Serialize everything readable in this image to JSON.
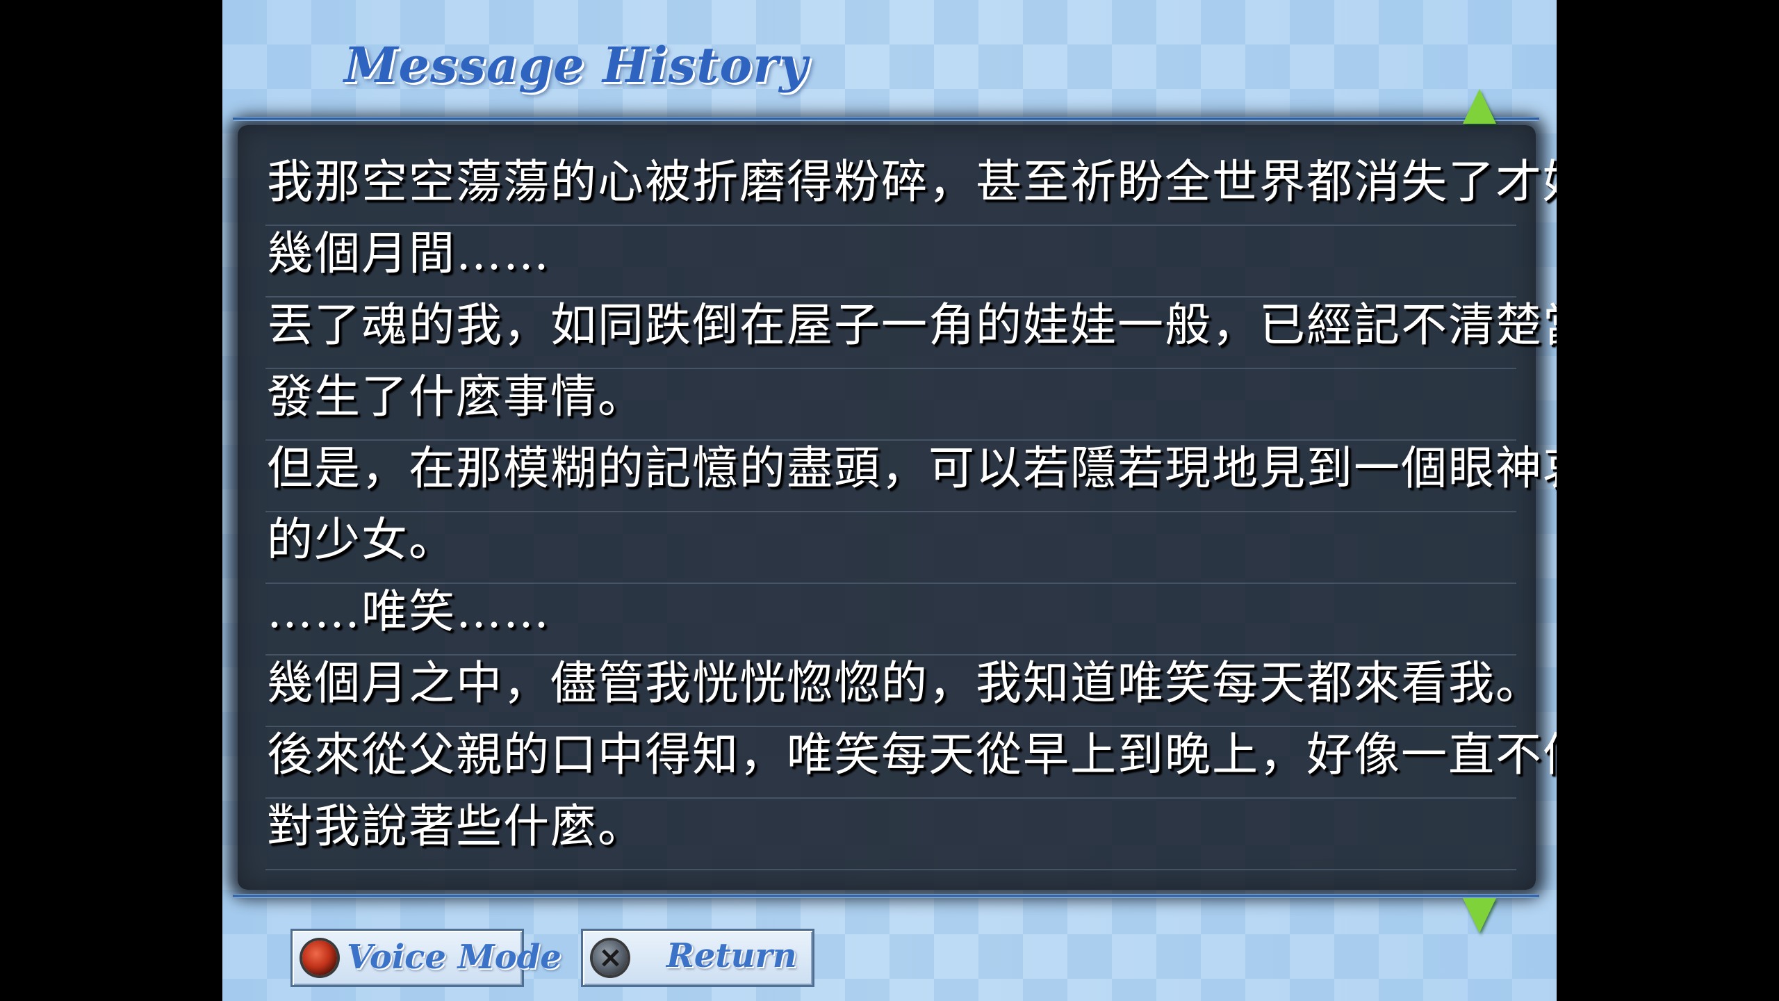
{
  "header": {
    "title": "Message History"
  },
  "history": {
    "lines": [
      "我那空空蕩蕩的心被折磨得粉碎，甚至祈盼全世界都消失了才好。",
      "幾個月間……",
      "丟了魂的我，如同跌倒在屋子一角的娃娃一般，已經記不清楚當時",
      "發生了什麼事情。",
      "但是，在那模糊的記憶的盡頭，可以若隱若現地見到一個眼神哀怨",
      "的少女。",
      "……唯笑……",
      "幾個月之中，儘管我恍恍惚惚的，我知道唯笑每天都來看我。",
      "後來從父親的口中得知，唯笑每天從早上到晚上，好像一直不停地",
      "對我說著些什麼。"
    ]
  },
  "controls": {
    "voice_mode_label": "Voice Mode",
    "voice_mode_icon": "circle-button-icon",
    "return_label": "Return",
    "return_icon": "cross-button-icon",
    "scroll_up_icon": "triangle-up-icon",
    "scroll_down_icon": "triangle-down-icon"
  },
  "colors": {
    "panel": "#202834",
    "title": "#2f63c0",
    "arrow": "#7fd23a",
    "background": "#a9cdee"
  }
}
